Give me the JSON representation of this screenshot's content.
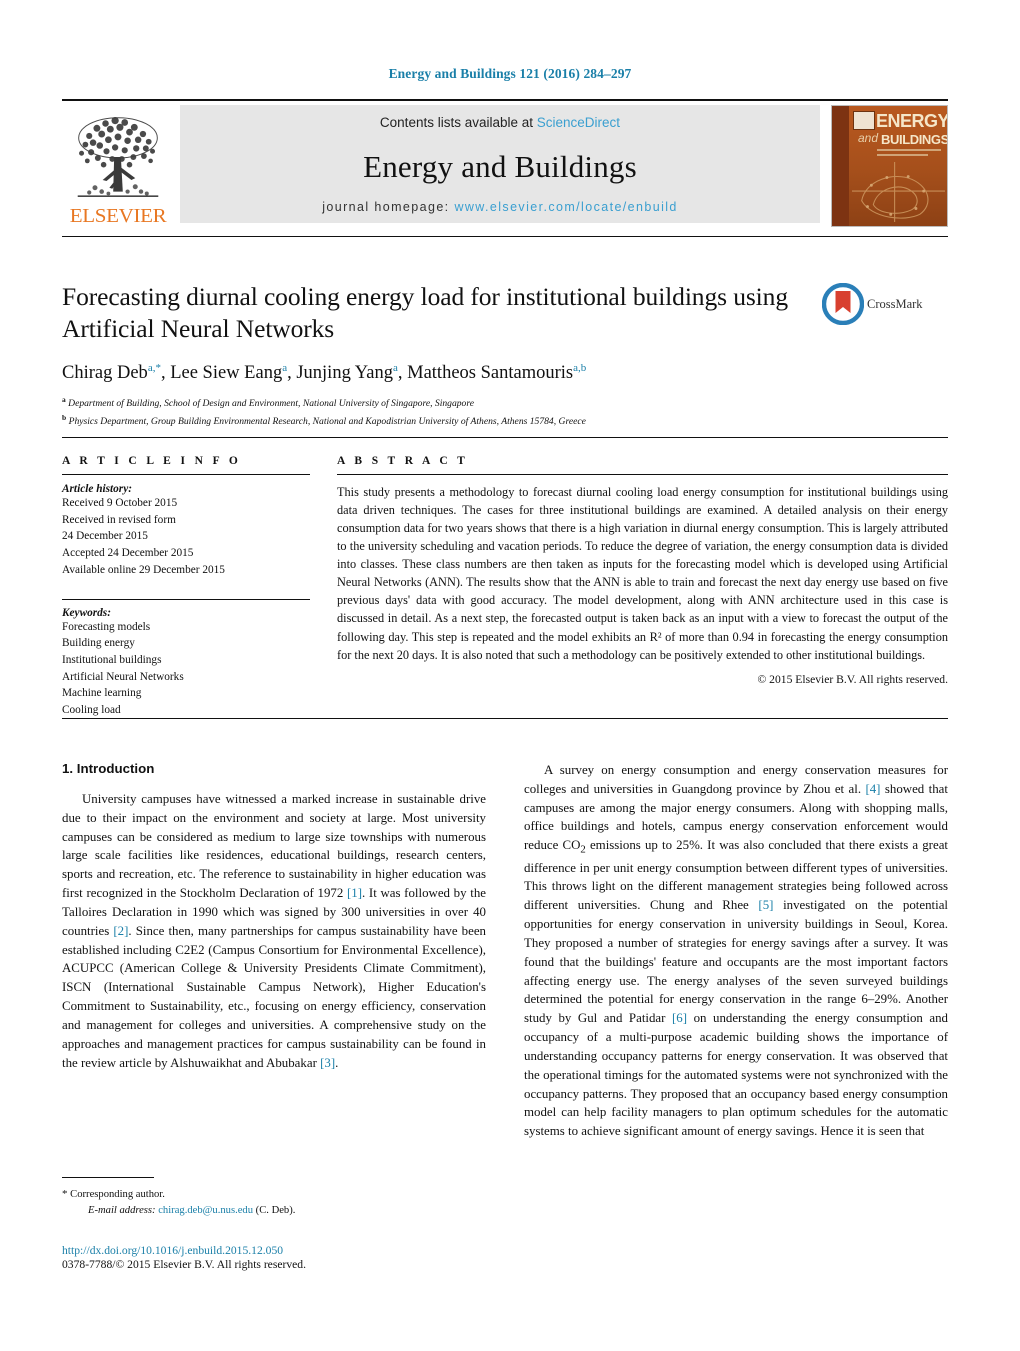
{
  "running_head": "Energy and Buildings 121 (2016) 284–297",
  "masthead": {
    "publisher_name": "ELSEVIER",
    "contents_prefix": "Contents lists available at",
    "contents_link": "ScienceDirect",
    "journal_name": "Energy and Buildings",
    "homepage_prefix": "journal homepage:",
    "homepage_link": "www.elsevier.com/locate/enbuild",
    "cover": {
      "line_and": "and",
      "line_energy": "ENERGY",
      "line_buildings": "BUILDINGS"
    }
  },
  "article": {
    "title": "Forecasting diurnal cooling energy load for institutional buildings using Artificial Neural Networks",
    "crossmark_label": "CrossMark",
    "authors_html": "Chirag Deb<sup>a,<span class=\"star\">*</span></sup>, Lee Siew Eang<sup>a</sup>, Junjing Yang<sup>a</sup>, Mattheos Santamouris<sup>a,b</sup>",
    "affiliations": [
      {
        "marker": "a",
        "text": "Department of Building, School of Design and Environment, National University of Singapore, Singapore"
      },
      {
        "marker": "b",
        "text": "Physics Department, Group Building Environmental Research, National and Kapodistrian University of Athens, Athens 15784, Greece"
      }
    ]
  },
  "article_info": {
    "heading": "A R T I C L E   I N F O",
    "history_title": "Article history:",
    "history": [
      "Received 9 October 2015",
      "Received in revised form",
      "24 December 2015",
      "Accepted 24 December 2015",
      "Available online 29 December 2015"
    ],
    "keywords_title": "Keywords:",
    "keywords": [
      "Forecasting models",
      "Building energy",
      "Institutional buildings",
      "Artificial Neural Networks",
      "Machine learning",
      "Cooling load"
    ]
  },
  "abstract": {
    "heading": "A B S T R A C T",
    "text": "This study presents a methodology to forecast diurnal cooling load energy consumption for institutional buildings using data driven techniques. The cases for three institutional buildings are examined. A detailed analysis on their energy consumption data for two years shows that there is a high variation in diurnal energy consumption. This is largely attributed to the university scheduling and vacation periods. To reduce the degree of variation, the energy consumption data is divided into classes. These class numbers are then taken as inputs for the forecasting model which is developed using Artificial Neural Networks (ANN). The results show that the ANN is able to train and forecast the next day energy use based on five previous days' data with good accuracy. The model development, along with ANN architecture used in this case is discussed in detail. As a next step, the forecasted output is taken back as an input with a view to forecast the output of the following day. This step is repeated and the model exhibits an R² of more than 0.94 in forecasting the energy consumption for the next 20 days. It is also noted that such a methodology can be positively extended to other institutional buildings.",
    "copyright": "© 2015 Elsevier B.V. All rights reserved."
  },
  "introduction": {
    "heading": "1.  Introduction",
    "left_paragraph_html": "University campuses have witnessed a marked increase in sustainable drive due to their impact on the environment and society at large. Most university campuses can be considered as medium to large size townships with numerous large scale facilities like residences, educational buildings, research centers, sports and recreation, etc. The reference to sustainability in higher education was first recognized in the Stockholm Declaration of 1972 <span class=\"ref\">[1]</span>. It was followed by the Talloires Declaration in 1990 which was signed by 300 universities in over 40 countries <span class=\"ref\">[2]</span>. Since then, many partnerships for campus sustainability have been established including C2E2 (Campus Consortium for Environmental Excellence), ACUPCC (American College &amp; University Presidents Climate Commitment), ISCN (International Sustainable Campus Network), Higher Education's Commitment to Sustainability, etc., focusing on energy efficiency, conservation and management for colleges and universities. A comprehensive study on the approaches and management practices for campus sustainability can be found in the review article by Alshuwaikhat and Abubakar <span class=\"ref\">[3]</span>.",
    "right_paragraph_html": "A survey on energy consumption and energy conservation measures for colleges and universities in Guangdong province by Zhou et al. <span class=\"ref\">[4]</span> showed that campuses are among the major energy consumers. Along with shopping malls, office buildings and hotels, campus energy conservation enforcement would reduce CO<sub>2</sub> emissions up to 25%. It was also concluded that there exists a great difference in per unit energy consumption between different types of universities. This throws light on the different management strategies being followed across different universities. Chung and Rhee <span class=\"ref\">[5]</span> investigated on the potential opportunities for energy conservation in university buildings in Seoul, Korea. They proposed a number of strategies for energy savings after a survey. It was found that the buildings' feature and occupants are the most important factors affecting energy use. The energy analyses of the seven surveyed buildings determined the potential for energy conservation in the range 6–29%. Another study by Gul and Patidar <span class=\"ref\">[6]</span> on understanding the energy consumption and occupancy of a multi-purpose academic building shows the importance of understanding occupancy patterns for energy conservation. It was observed that the operational timings for the automated systems were not synchronized with the occupancy patterns. They proposed that an occupancy based energy consumption model can help facility managers to plan optimum schedules for the automatic systems to achieve significant amount of energy savings. Hence it is seen that"
  },
  "footnote": {
    "corresponding_star": "*",
    "corresponding_text": "Corresponding author.",
    "email_label": "E-mail address:",
    "email": "chirag.deb@u.nus.edu",
    "email_suffix": "(C. Deb)."
  },
  "doi": {
    "url": "http://dx.doi.org/10.1016/j.enbuild.2015.12.050",
    "issn_line": "0378-7788/© 2015 Elsevier B.V. All rights reserved."
  },
  "colors": {
    "link": "#1a7fa8",
    "sciencedirect": "#3a9fd0",
    "elsevier_orange": "#E87722",
    "band": "#e6e6e6",
    "crossmark_blue": "#2a7fb8",
    "crossmark_red": "#d8402f"
  }
}
